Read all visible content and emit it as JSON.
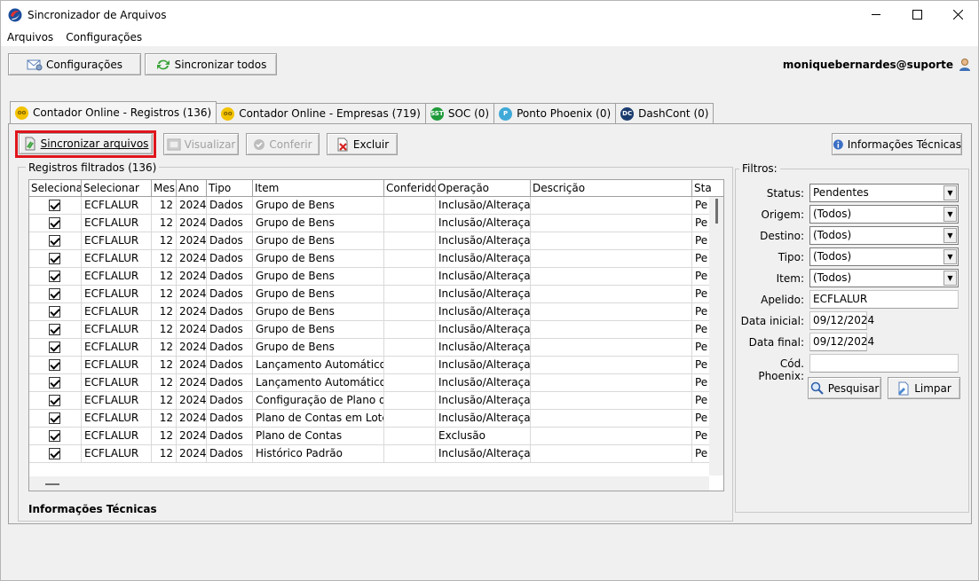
{
  "window": {
    "title": "Sincronizador de Arquivos"
  },
  "menu": [
    "Arquivos",
    "Configurações"
  ],
  "toolbar": {
    "config_label": "Configurações",
    "sync_all_label": "Sincronizar todos"
  },
  "user": {
    "name": "moniquebernardes@suporte"
  },
  "tabs": [
    {
      "label": "Contador Online - Registros (136)",
      "icon": "chat-icon",
      "color": "#f2c200"
    },
    {
      "label": "Contador Online - Empresas (719)",
      "icon": "chat-icon",
      "color": "#f2c200"
    },
    {
      "label": "SOC (0)",
      "icon": "sst-icon",
      "color": "#1f9b3a"
    },
    {
      "label": "Ponto Phoenix (0)",
      "icon": "phoenix-icon",
      "color": "#3fa9d8"
    },
    {
      "label": "DashCont (0)",
      "icon": "dc-icon",
      "color": "#1b3c6e"
    }
  ],
  "actions": {
    "sync_files": "Sincronizar arquivos",
    "view": "Visualizar",
    "confirm": "Conferir",
    "delete": "Excluir",
    "tech_info": "Informações Técnicas"
  },
  "records": {
    "legend": "Registros filtrados (136)",
    "columns": [
      "Selecionar",
      "Selecionar",
      "Mes",
      "Ano",
      "Tipo",
      "Item",
      "Conferido",
      "Operação",
      "Descrição",
      "Sta"
    ],
    "rows": [
      {
        "checked": true,
        "apelido": "ECFLALUR",
        "mes": "12",
        "ano": "2024",
        "tipo": "Dados",
        "item": "Grupo de Bens",
        "conferido": "",
        "operacao": "Inclusão/Alteraçao",
        "descricao": "",
        "status": "Pe"
      },
      {
        "checked": true,
        "apelido": "ECFLALUR",
        "mes": "12",
        "ano": "2024",
        "tipo": "Dados",
        "item": "Grupo de Bens",
        "conferido": "",
        "operacao": "Inclusão/Alteraçao",
        "descricao": "",
        "status": "Pe"
      },
      {
        "checked": true,
        "apelido": "ECFLALUR",
        "mes": "12",
        "ano": "2024",
        "tipo": "Dados",
        "item": "Grupo de Bens",
        "conferido": "",
        "operacao": "Inclusão/Alteraçao",
        "descricao": "",
        "status": "Pe"
      },
      {
        "checked": true,
        "apelido": "ECFLALUR",
        "mes": "12",
        "ano": "2024",
        "tipo": "Dados",
        "item": "Grupo de Bens",
        "conferido": "",
        "operacao": "Inclusão/Alteraçao",
        "descricao": "",
        "status": "Pe"
      },
      {
        "checked": true,
        "apelido": "ECFLALUR",
        "mes": "12",
        "ano": "2024",
        "tipo": "Dados",
        "item": "Grupo de Bens",
        "conferido": "",
        "operacao": "Inclusão/Alteraçao",
        "descricao": "",
        "status": "Pe"
      },
      {
        "checked": true,
        "apelido": "ECFLALUR",
        "mes": "12",
        "ano": "2024",
        "tipo": "Dados",
        "item": "Grupo de Bens",
        "conferido": "",
        "operacao": "Inclusão/Alteraçao",
        "descricao": "",
        "status": "Pe"
      },
      {
        "checked": true,
        "apelido": "ECFLALUR",
        "mes": "12",
        "ano": "2024",
        "tipo": "Dados",
        "item": "Grupo de Bens",
        "conferido": "",
        "operacao": "Inclusão/Alteraçao",
        "descricao": "",
        "status": "Pe"
      },
      {
        "checked": true,
        "apelido": "ECFLALUR",
        "mes": "12",
        "ano": "2024",
        "tipo": "Dados",
        "item": "Grupo de Bens",
        "conferido": "",
        "operacao": "Inclusão/Alteraçao",
        "descricao": "",
        "status": "Pe"
      },
      {
        "checked": true,
        "apelido": "ECFLALUR",
        "mes": "12",
        "ano": "2024",
        "tipo": "Dados",
        "item": "Grupo de Bens",
        "conferido": "",
        "operacao": "Inclusão/Alteraçao",
        "descricao": "",
        "status": "Pe"
      },
      {
        "checked": true,
        "apelido": "ECFLALUR",
        "mes": "12",
        "ano": "2024",
        "tipo": "Dados",
        "item": "Lançamento Automático",
        "conferido": "",
        "operacao": "Inclusão/Alteraçao",
        "descricao": "",
        "status": "Pe"
      },
      {
        "checked": true,
        "apelido": "ECFLALUR",
        "mes": "12",
        "ano": "2024",
        "tipo": "Dados",
        "item": "Lançamento Automático",
        "conferido": "",
        "operacao": "Inclusão/Alteraçao",
        "descricao": "",
        "status": "Pe"
      },
      {
        "checked": true,
        "apelido": "ECFLALUR",
        "mes": "12",
        "ano": "2024",
        "tipo": "Dados",
        "item": "Configuração de Plano de C",
        "conferido": "",
        "operacao": "Inclusão/Alteraçao",
        "descricao": "",
        "status": "Pe"
      },
      {
        "checked": true,
        "apelido": "ECFLALUR",
        "mes": "12",
        "ano": "2024",
        "tipo": "Dados",
        "item": "Plano de Contas em Lote",
        "conferido": "",
        "operacao": "Inclusão/Alteraçao",
        "descricao": "",
        "status": "Pe"
      },
      {
        "checked": true,
        "apelido": "ECFLALUR",
        "mes": "12",
        "ano": "2024",
        "tipo": "Dados",
        "item": "Plano de Contas",
        "conferido": "",
        "operacao": "Exclusão",
        "descricao": "",
        "status": "Pe"
      },
      {
        "checked": true,
        "apelido": "ECFLALUR",
        "mes": "12",
        "ano": "2024",
        "tipo": "Dados",
        "item": "Histórico Padrão",
        "conferido": "",
        "operacao": "Inclusão/Alteraçao",
        "descricao": "",
        "status": "Pe"
      }
    ]
  },
  "tech_info_label": "Informações Técnicas",
  "filters": {
    "legend": "Filtros:",
    "status_label": "Status:",
    "status_value": "Pendentes",
    "origem_label": "Origem:",
    "origem_value": "(Todos)",
    "destino_label": "Destino:",
    "destino_value": "(Todos)",
    "tipo_label": "Tipo:",
    "tipo_value": "(Todos)",
    "item_label": "Item:",
    "item_value": "(Todos)",
    "apelido_label": "Apelido:",
    "apelido_value": "ECFLALUR",
    "data_inicial_label": "Data inicial:",
    "data_inicial_value": "09/12/2024",
    "data_final_label": "Data final:",
    "data_final_value": "09/12/2024",
    "cod_phoenix_label": "Cód. Phoenix:",
    "cod_phoenix_value": "",
    "search_label": "Pesquisar",
    "clear_label": "Limpar"
  }
}
